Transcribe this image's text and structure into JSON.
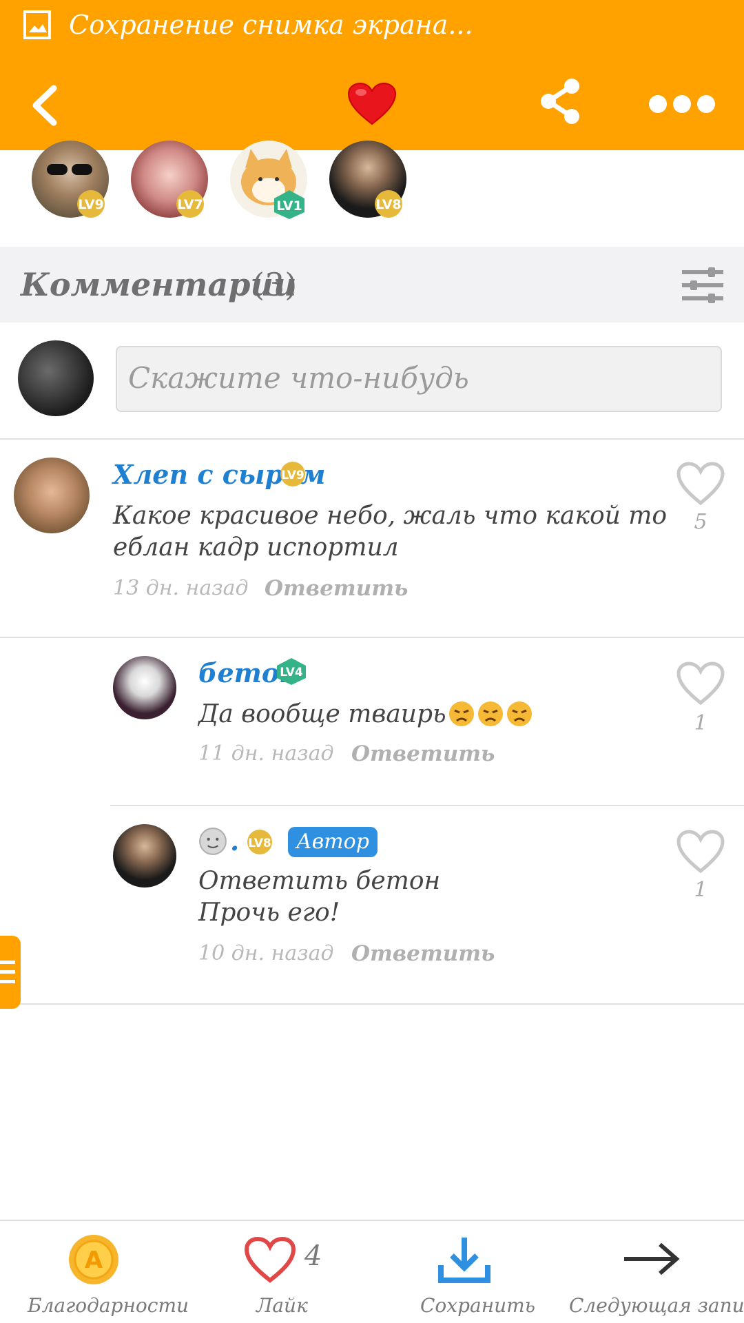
{
  "status_bar": {
    "title": "Сохранение снимка экрана..."
  },
  "header": {
    "back_icon": "chevron-left-icon",
    "like_icon": "heart-icon",
    "share_icon": "share-icon",
    "more_icon": "more-dots-icon"
  },
  "likers": [
    {
      "level": "LV9"
    },
    {
      "level": "LV7"
    },
    {
      "level": "LV1"
    },
    {
      "level": "LV8"
    }
  ],
  "comments_section": {
    "title": "Комментарии",
    "count": "(3)"
  },
  "composer": {
    "placeholder": "Скажите что-нибудь"
  },
  "comments": [
    {
      "author": "Хлеп с сыром",
      "level": "LV9",
      "line1": "Какое красивое небо, жаль что какой то",
      "line2": "еблан кадр испортил",
      "time": "13 дн. назад",
      "reply": "Ответить",
      "likes": "5"
    },
    {
      "author": "бетон",
      "level": "LV4",
      "line1": "Да вообще тваирь",
      "time": "11 дн. назад",
      "reply": "Ответить",
      "likes": "1"
    },
    {
      "author": ".",
      "level": "LV8",
      "author_badge": "Автор",
      "line1": "Ответить бетон",
      "line2": "Прочь его!",
      "time": "10 дн. назад",
      "reply": "Ответить",
      "likes": "1"
    }
  ],
  "bottom_bar": {
    "thanks": "Благодарности",
    "like": "Лайк",
    "like_count": "4",
    "save": "Сохранить",
    "next": "Следующая запись"
  },
  "colors": {
    "accent": "#ffa200",
    "link": "#1f7fd0",
    "author_badge": "#2f8fe0"
  }
}
